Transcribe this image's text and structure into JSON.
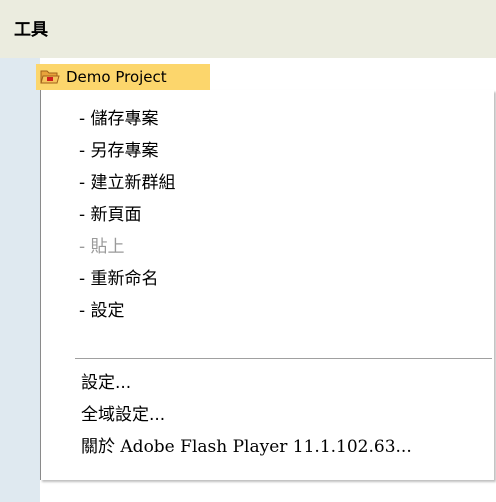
{
  "toolbar": {
    "title": "工具"
  },
  "tree": {
    "project_name": "Demo Project",
    "project_icon": "folder-open-icon"
  },
  "context_menu": {
    "items": [
      {
        "label": "- 儲存專案",
        "enabled": true
      },
      {
        "label": "- 另存專案",
        "enabled": true
      },
      {
        "label": "- 建立新群組",
        "enabled": true
      },
      {
        "label": "- 新頁面",
        "enabled": true
      },
      {
        "label": "- 貼上",
        "enabled": false
      },
      {
        "label": "- 重新命名",
        "enabled": true
      },
      {
        "label": "- 設定",
        "enabled": true
      }
    ],
    "system_items": [
      {
        "label": "設定..."
      },
      {
        "label": "全域設定..."
      },
      {
        "label": "關於 Adobe Flash Player 11.1.102.63..."
      }
    ]
  },
  "colors": {
    "titlebar_bg": "#ebecdf",
    "selection_bg": "#fcd66c",
    "strip_bg": "#dfe9f0",
    "disabled_text": "#9a9a9a"
  }
}
